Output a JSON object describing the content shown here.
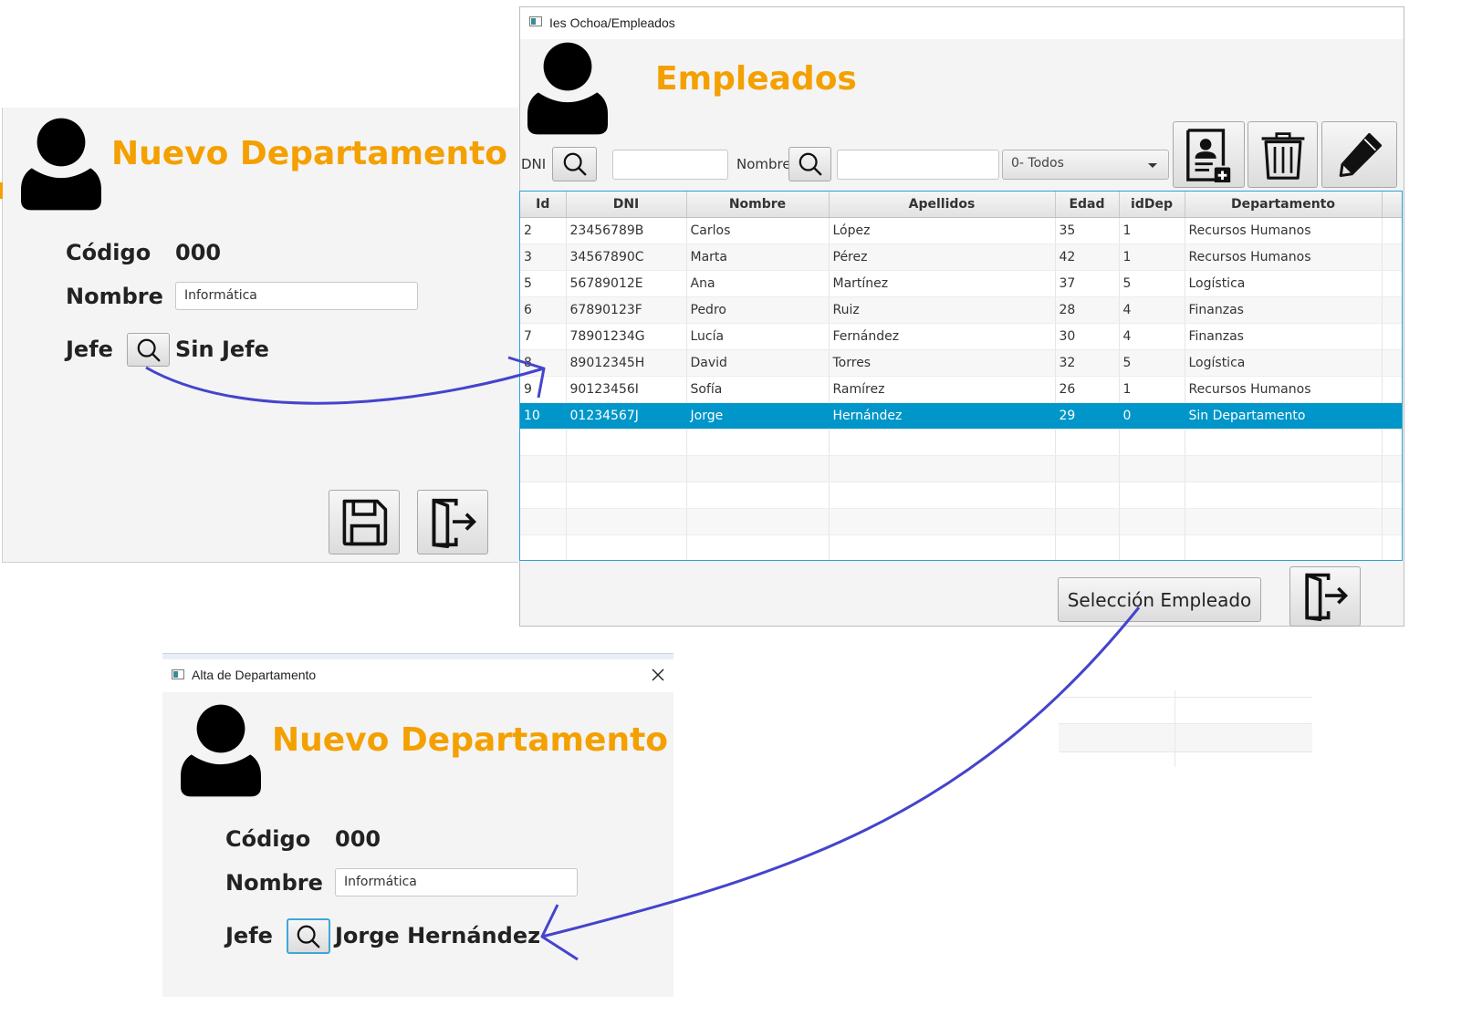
{
  "dialog1": {
    "title": "Nuevo Departamento",
    "codigo_label": "Código",
    "codigo_value": "000",
    "nombre_label": "Nombre",
    "nombre_value": "Informática",
    "jefe_label": "Jefe",
    "jefe_value": "Sin Jefe"
  },
  "empleados": {
    "window_title": "Ies Ochoa/Empleados",
    "title": "Empleados",
    "dni_label": "DNI",
    "nombre_label": "Nombre",
    "filter_selected": "0- Todos",
    "columns": [
      "Id",
      "DNI",
      "Nombre",
      "Apellidos",
      "Edad",
      "idDep",
      "Departamento"
    ],
    "rows": [
      [
        "2",
        "23456789B",
        "Carlos",
        "López",
        "35",
        "1",
        "Recursos Humanos"
      ],
      [
        "3",
        "34567890C",
        "Marta",
        "Pérez",
        "42",
        "1",
        "Recursos Humanos"
      ],
      [
        "5",
        "56789012E",
        "Ana",
        "Martínez",
        "37",
        "5",
        "Logística"
      ],
      [
        "6",
        "67890123F",
        "Pedro",
        "Ruiz",
        "28",
        "4",
        "Finanzas"
      ],
      [
        "7",
        "78901234G",
        "Lucía",
        "Fernández",
        "30",
        "4",
        "Finanzas"
      ],
      [
        "8",
        "89012345H",
        "David",
        "Torres",
        "32",
        "5",
        "Logística"
      ],
      [
        "9",
        "90123456I",
        "Sofía",
        "Ramírez",
        "26",
        "1",
        "Recursos Humanos"
      ],
      [
        "10",
        "01234567J",
        "Jorge",
        "Hernández",
        "29",
        "0",
        "Sin Departamento"
      ]
    ],
    "selected_row_index": 7,
    "select_button": "Selección Empleado"
  },
  "dialog2": {
    "window_title": "Alta de Departamento",
    "title": "Nuevo Departamento",
    "codigo_label": "Código",
    "codigo_value": "000",
    "nombre_label": "Nombre",
    "nombre_value": "Informática",
    "jefe_label": "Jefe",
    "jefe_value": "Jorge Hernández"
  },
  "colors": {
    "title": "#f4a000",
    "selection": "#0096c9",
    "arrow": "#4444cc"
  }
}
